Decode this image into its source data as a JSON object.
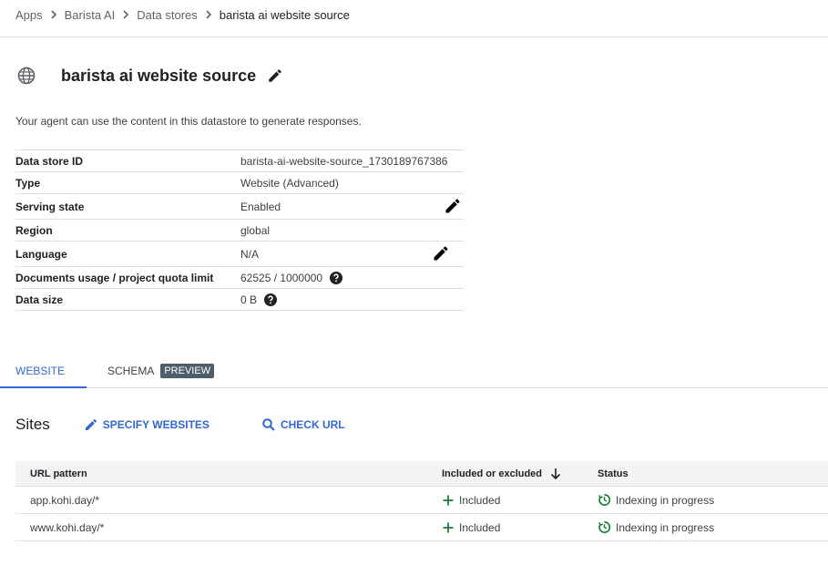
{
  "breadcrumb": {
    "items": [
      "Apps",
      "Barista AI",
      "Data stores",
      "barista ai website source"
    ]
  },
  "header": {
    "title": "barista ai website source",
    "description": "Your agent can use the content in this datastore to generate responses."
  },
  "properties": [
    {
      "key": "Data store ID",
      "value": "barista-ai-website-source_1730189767386"
    },
    {
      "key": "Type",
      "value": "Website (Advanced)"
    },
    {
      "key": "Serving state",
      "value": "Enabled"
    },
    {
      "key": "Region",
      "value": "global"
    },
    {
      "key": "Language",
      "value": "N/A"
    },
    {
      "key": "Documents usage / project quota limit",
      "value": "62525 / 1000000"
    },
    {
      "key": "Data size",
      "value": "0 B"
    }
  ],
  "tabs": {
    "website": "WEBSITE",
    "schema": "SCHEMA",
    "preview_badge": "PREVIEW",
    "active": "website"
  },
  "sites": {
    "title": "Sites",
    "specify_label": "SPECIFY WEBSITES",
    "check_label": "CHECK URL",
    "columns": [
      "URL pattern",
      "Included or excluded",
      "Status"
    ],
    "rows": [
      {
        "url": "app.kohi.day/*",
        "included": "Included",
        "status": "Indexing in progress"
      },
      {
        "url": "www.kohi.day/*",
        "included": "Included",
        "status": "Indexing in progress"
      }
    ]
  },
  "colors": {
    "accent": "#3367d6",
    "success": "#188038",
    "badge": "#4d5d6a"
  },
  "icons": [
    "chevron-right-icon",
    "globe-icon",
    "pencil-icon",
    "help-icon",
    "search-icon",
    "arrow-down-icon",
    "plus-icon",
    "status-progress-icon"
  ]
}
